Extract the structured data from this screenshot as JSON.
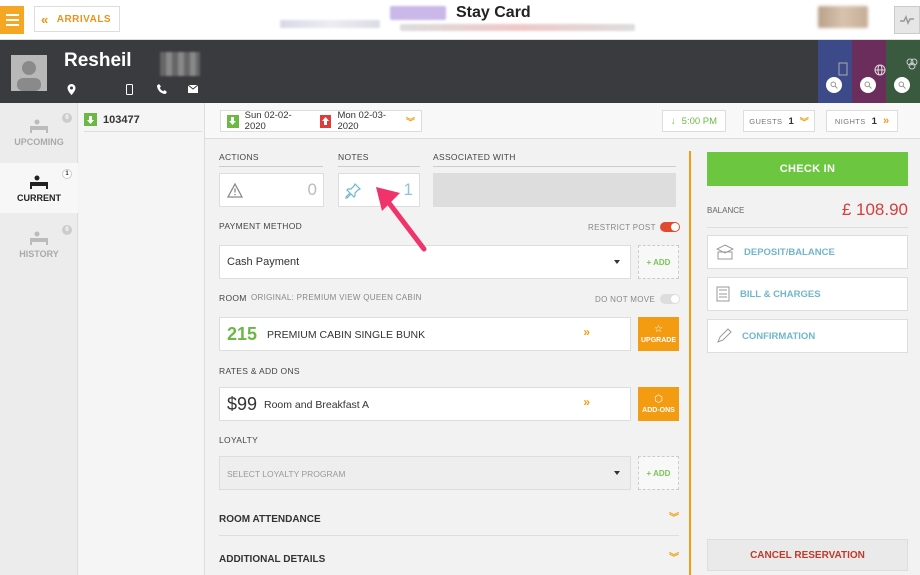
{
  "topbar": {
    "arrivals_label": "ARRIVALS",
    "title": "Stay Card"
  },
  "guest": {
    "name": "Resheil"
  },
  "sidebar": {
    "items": [
      {
        "label": "UPCOMING",
        "count": "0"
      },
      {
        "label": "CURRENT",
        "count": "1"
      },
      {
        "label": "HISTORY",
        "count": "0"
      }
    ]
  },
  "reservation": {
    "number": "103477"
  },
  "dates": {
    "arrival": "Sun 02-02-2020",
    "departure": "Mon 02-03-2020",
    "time": "5:00 PM",
    "guests_label": "GUESTS",
    "guests_value": "1",
    "nights_label": "NIGHTS",
    "nights_value": "1"
  },
  "actions": {
    "label": "ACTIONS",
    "count": "0"
  },
  "notes": {
    "label": "NOTES",
    "count": "1"
  },
  "associated": {
    "label": "ASSOCIATED WITH"
  },
  "payment": {
    "label": "PAYMENT METHOD",
    "restrict_label": "RESTRICT POST",
    "value": "Cash Payment",
    "add_label": "+ ADD"
  },
  "room": {
    "label": "ROOM",
    "original": "ORIGINAL: PREMIUM VIEW QUEEN CABIN",
    "do_not_move_label": "DO NOT MOVE",
    "number": "215",
    "type": "PREMIUM CABIN SINGLE BUNK",
    "upgrade_label": "UPGRADE"
  },
  "rates": {
    "label": "RATES & ADD ONS",
    "price": "$99",
    "name": "Room and Breakfast A",
    "addons_label": "ADD-ONS"
  },
  "loyalty": {
    "label": "LOYALTY",
    "placeholder": "SELECT LOYALTY PROGRAM",
    "add_label": "+ ADD"
  },
  "sections": {
    "room_attendance": "ROOM ATTENDANCE",
    "additional_details": "ADDITIONAL DETAILS"
  },
  "right": {
    "checkin_label": "CHECK IN",
    "balance_label": "BALANCE",
    "balance_value": "£ 108.90",
    "deposit_label": "DEPOSIT/BALANCE",
    "bill_label": "BILL & CHARGES",
    "confirmation_label": "CONFIRMATION",
    "cancel_label": "CANCEL RESERVATION"
  },
  "colors": {
    "accent": "#f39c12",
    "checkin": "#6cc63f",
    "balance": "#d63e3e",
    "header": "#3a3b3f"
  }
}
